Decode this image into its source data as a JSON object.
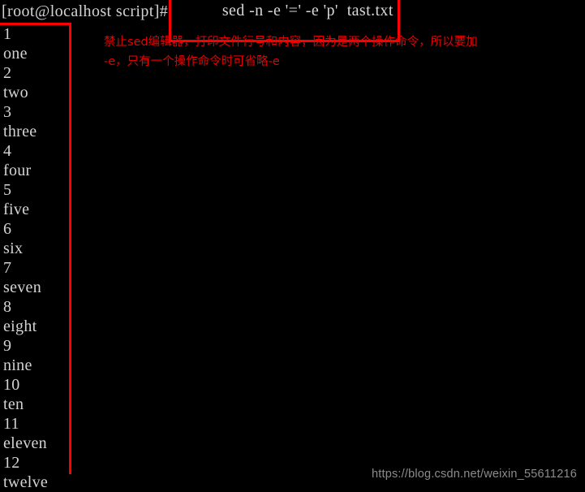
{
  "terminal": {
    "background_color": "#000000",
    "text_color": "#d3d3d3",
    "highlight_color": "#ff0000",
    "prompt": "[root@localhost script]#",
    "command": "sed -n -e '=' -e 'p'  tast.txt",
    "output_lines": [
      "1",
      "one",
      "2",
      "two",
      "3",
      "three",
      "4",
      "four",
      "5",
      "five",
      "6",
      "six",
      "7",
      "seven",
      "8",
      "eight",
      "9",
      "nine",
      "10",
      "ten",
      "11",
      "eleven",
      "12",
      "twelve"
    ]
  },
  "annotation": {
    "color": "#e60000",
    "line1": "禁止sed编辑器，打印文件行号和内容，因为是两个操作命令，所以要加",
    "line2": "-e，只有一个操作命令时可省略-e"
  },
  "watermark": {
    "text": "https://blog.csdn.net/weixin_55611216",
    "color": "#8c8c8c"
  }
}
